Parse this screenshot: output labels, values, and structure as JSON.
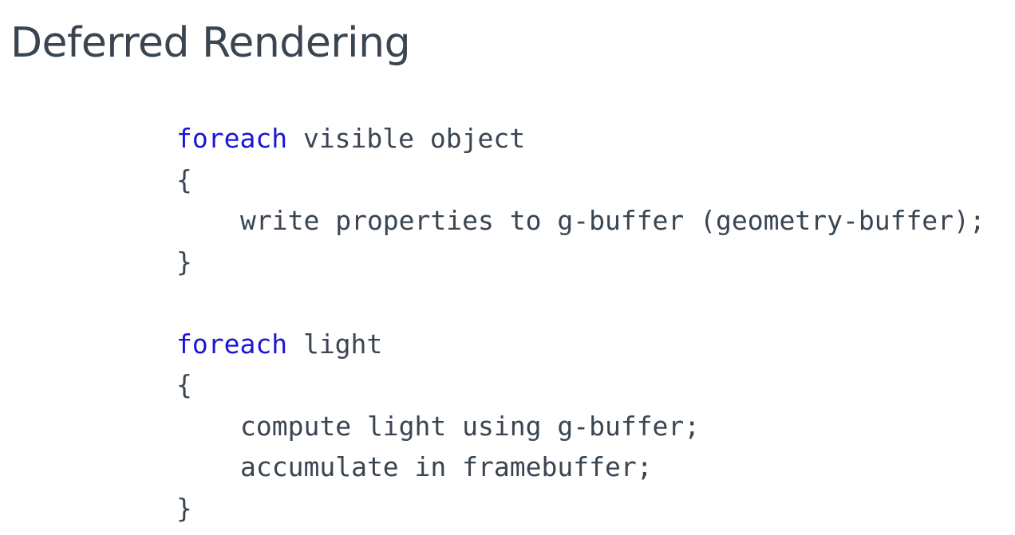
{
  "slide": {
    "title": "Deferred Rendering"
  },
  "colors": {
    "title_text": "#3a4552",
    "code_text": "#3a4552",
    "keyword": "#1a16d8",
    "background": "#ffffff"
  },
  "code": {
    "lines": [
      {
        "keyword": "foreach",
        "text": " visible object"
      },
      {
        "text": "{"
      },
      {
        "text": "write properties to g-buffer (geometry-buffer);"
      },
      {
        "text": "}"
      },
      {
        "text": ""
      },
      {
        "keyword": "foreach",
        "text": " light"
      },
      {
        "text": "{"
      },
      {
        "text": "compute light using g-buffer;"
      },
      {
        "text": "accumulate in framebuffer;"
      },
      {
        "text": "}"
      }
    ]
  }
}
